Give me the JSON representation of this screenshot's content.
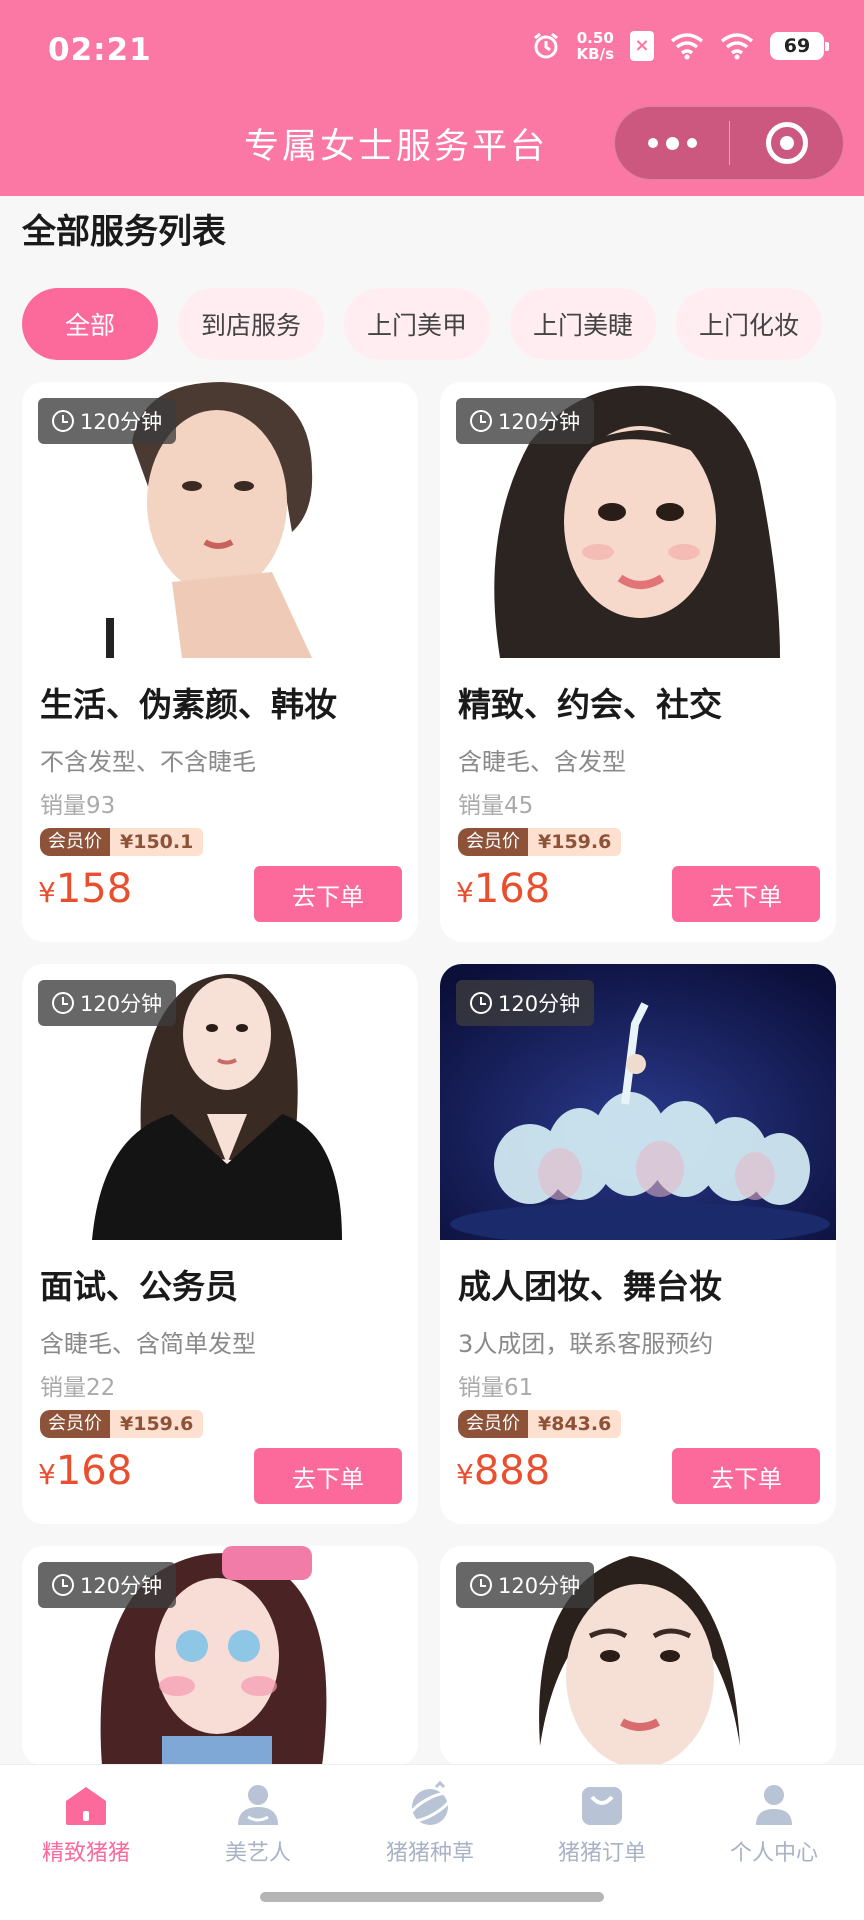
{
  "status_bar": {
    "time": "02:21",
    "net_speed_value": "0.50",
    "net_speed_unit": "KB/s",
    "battery": "69"
  },
  "nav": {
    "title": "专属女士服务平台"
  },
  "section": {
    "title": "全部服务列表"
  },
  "filters": [
    {
      "label": "全部",
      "active": true
    },
    {
      "label": "到店服务",
      "active": false
    },
    {
      "label": "上门美甲",
      "active": false
    },
    {
      "label": "上门美睫",
      "active": false
    },
    {
      "label": "上门化妆",
      "active": false
    }
  ],
  "cards": [
    {
      "duration": "120分钟",
      "title": "生活、伪素颜、韩妆",
      "desc": "不含发型、不含睫毛",
      "sales": "销量93",
      "member_label": "会员价",
      "member_price": "¥150.1",
      "currency": "¥",
      "price": "158",
      "button": "去下单"
    },
    {
      "duration": "120分钟",
      "title": "精致、约会、社交",
      "desc": "含睫毛、含发型",
      "sales": "销量45",
      "member_label": "会员价",
      "member_price": "¥159.6",
      "currency": "¥",
      "price": "168",
      "button": "去下单"
    },
    {
      "duration": "120分钟",
      "title": "面试、公务员",
      "desc": "含睫毛、含简单发型",
      "sales": "销量22",
      "member_label": "会员价",
      "member_price": "¥159.6",
      "currency": "¥",
      "price": "168",
      "button": "去下单"
    },
    {
      "duration": "120分钟",
      "title": "成人团妆、舞台妆",
      "desc": "3人成团，联系客服预约",
      "sales": "销量61",
      "member_label": "会员价",
      "member_price": "¥843.6",
      "currency": "¥",
      "price": "888",
      "button": "去下单"
    },
    {
      "duration": "120分钟"
    },
    {
      "duration": "120分钟"
    }
  ],
  "tabbar": [
    {
      "label": "精致猪猪",
      "icon": "home-icon",
      "active": true
    },
    {
      "label": "美艺人",
      "icon": "artist-icon",
      "active": false
    },
    {
      "label": "猪猪种草",
      "icon": "planet-icon",
      "active": false
    },
    {
      "label": "猪猪订单",
      "icon": "bag-icon",
      "active": false
    },
    {
      "label": "个人中心",
      "icon": "user-icon",
      "active": false
    }
  ],
  "colors": {
    "brand_pink": "#fb78a4",
    "button_pink": "#fb6a9b",
    "price_red": "#e94f2e",
    "member_brown": "#8d5238"
  }
}
